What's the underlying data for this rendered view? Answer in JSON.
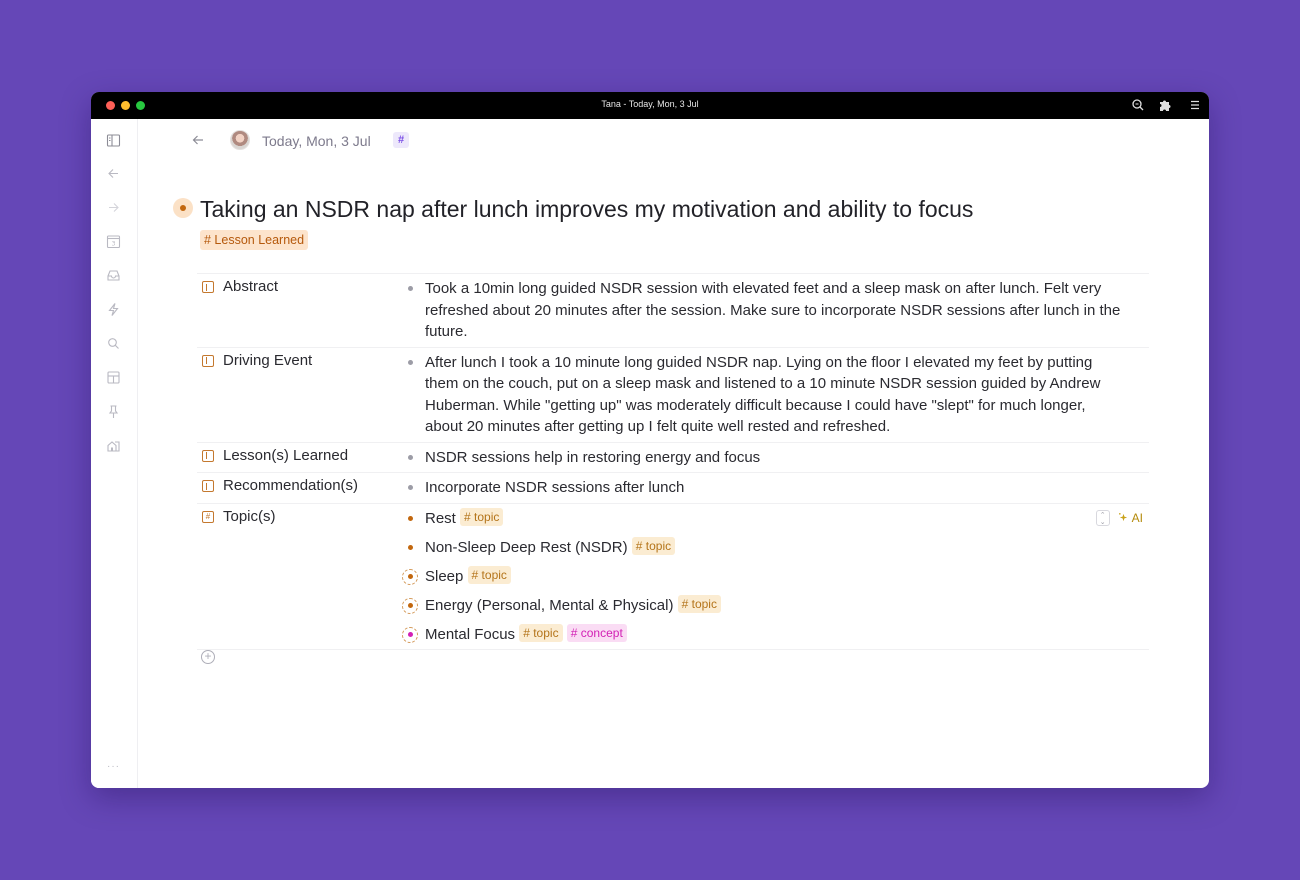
{
  "window": {
    "title": "Tana - Today, Mon, 3 Jul"
  },
  "titlebar_icons": [
    "search-zoom-icon",
    "puzzle-icon",
    "menu-icon"
  ],
  "sidebar": {
    "items": [
      {
        "name": "sidebar-toggle",
        "icon": "panel-icon"
      },
      {
        "name": "back",
        "icon": "arrow-left-icon"
      },
      {
        "name": "forward",
        "icon": "arrow-right-icon"
      },
      {
        "name": "calendar",
        "icon": "calendar-icon",
        "day": "3"
      },
      {
        "name": "inbox",
        "icon": "inbox-icon"
      },
      {
        "name": "quick-actions",
        "icon": "lightning-icon"
      },
      {
        "name": "search",
        "icon": "search-icon"
      },
      {
        "name": "layout",
        "icon": "layout-icon"
      },
      {
        "name": "pinned",
        "icon": "pin-icon"
      },
      {
        "name": "workspace",
        "icon": "home-icon"
      }
    ],
    "more_label": "···"
  },
  "breadcrumb": {
    "label": "Today, Mon, 3 Jul",
    "hash": "#"
  },
  "node": {
    "title": "Taking an NSDR nap after lunch improves my motivation and ability to focus",
    "tag": "# Lesson Learned",
    "tag_color": "#b5590c"
  },
  "fields": [
    {
      "label": "Abstract",
      "values": [
        "Took a 10min long guided NSDR session with elevated feet and a sleep mask on after lunch. Felt very refreshed about 20 minutes after the session. Make sure to incorporate NSDR sessions after lunch in the future."
      ]
    },
    {
      "label": "Driving Event",
      "values": [
        "After lunch I took a 10 minute long guided NSDR nap. Lying on the floor I elevated my feet by putting them on the couch, put on a sleep mask and listened to a 10 minute NSDR session guided by Andrew Huberman. While \"getting up\" was moderately difficult because I could have \"slept\" for much longer, about 20 minutes after getting up I felt quite well rested and refreshed."
      ]
    },
    {
      "label": "Lesson(s) Learned",
      "values": [
        "NSDR sessions help in restoring energy and focus"
      ]
    },
    {
      "label": "Recommendation(s)",
      "values": [
        "Incorporate NSDR sessions after lunch"
      ]
    },
    {
      "label": "Topic(s)",
      "ai_label": "AI",
      "topics": [
        {
          "text": "Rest",
          "tags": [
            "# topic"
          ]
        },
        {
          "text": "Non-Sleep Deep Rest (NSDR)",
          "tags": [
            "# topic"
          ]
        },
        {
          "text": "Sleep",
          "tags": [
            "# topic"
          ]
        },
        {
          "text": "Energy (Personal, Mental & Physical)",
          "tags": [
            "# topic"
          ]
        },
        {
          "text": "Mental Focus",
          "tags": [
            "# topic",
            "# concept"
          ]
        }
      ]
    }
  ],
  "colors": {
    "background": "#6547b7",
    "accent_orange": "#c2670e",
    "topic_tag": "#b4741a",
    "concept_tag": "#d21fb5",
    "hash_purple": "#7a4ee6"
  }
}
